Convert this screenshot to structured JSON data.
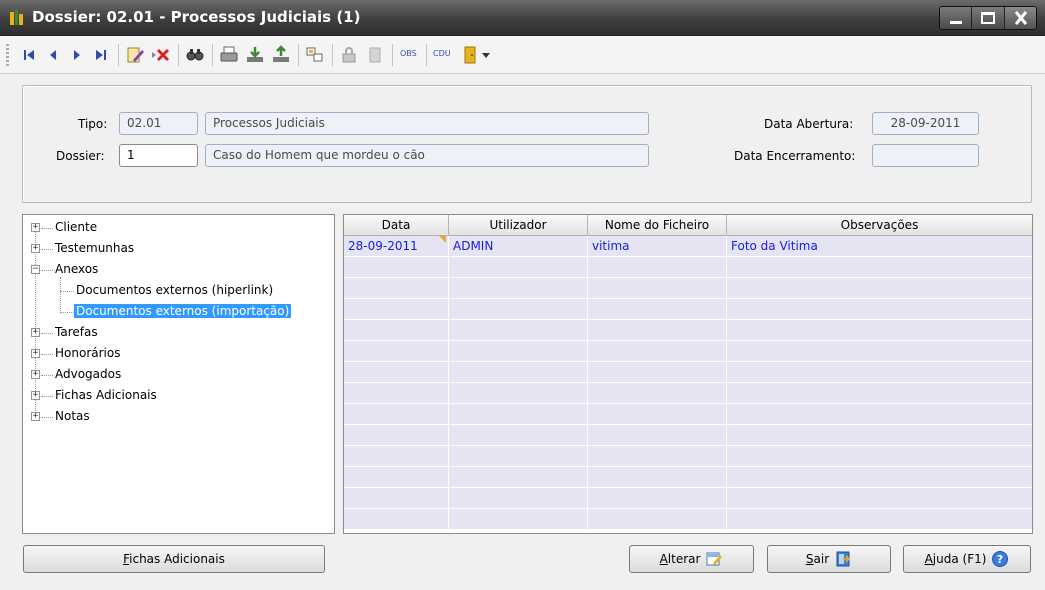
{
  "window": {
    "title": "Dossier: 02.01 - Processos Judiciais (1)",
    "controls": [
      "minimize-icon",
      "maximize-icon",
      "close-icon"
    ]
  },
  "toolbar": {
    "icons": [
      "first-record-icon",
      "previous-record-icon",
      "next-record-icon",
      "last-record-icon",
      "edit-record-icon",
      "delete-record-icon",
      "search-icon",
      "print-icon",
      "import-icon",
      "export-icon",
      "copy-icon",
      "lock-icon",
      "document-icon",
      "door-icon"
    ],
    "obs_label": "OBS",
    "cdu_label": "CDU"
  },
  "header": {
    "tipo_label": "Tipo:",
    "tipo_code": "02.01",
    "tipo_desc": "Processos Judiciais",
    "dossier_label": "Dossier:",
    "dossier_value": "1",
    "dossier_desc": "Caso do Homem que mordeu o cão",
    "data_abertura_label": "Data Abertura:",
    "data_abertura_value": "28-09-2011",
    "data_encerramento_label": "Data Encerramento:",
    "data_encerramento_value": ""
  },
  "tree": {
    "items": [
      {
        "label": "Cliente"
      },
      {
        "label": "Testemunhas"
      },
      {
        "label": "Anexos"
      },
      {
        "label": "Documentos externos (hiperlink)"
      },
      {
        "label": "Documentos externos (importação)"
      },
      {
        "label": "Tarefas"
      },
      {
        "label": "Honorários"
      },
      {
        "label": "Advogados"
      },
      {
        "label": "Fichas Adicionais"
      },
      {
        "label": "Notas"
      }
    ]
  },
  "grid": {
    "columns": [
      "Data",
      "Utilizador",
      "Nome do Ficheiro",
      "Observações"
    ],
    "rows": [
      {
        "data": "28-09-2011",
        "utilizador": "ADMIN",
        "ficheiro": "vitima",
        "obs": "Foto da Vitima"
      }
    ]
  },
  "buttons": {
    "fichas_first": "F",
    "fichas_rest": "ichas Adicionais",
    "alterar_first": "A",
    "alterar_rest": "lterar",
    "sair_first": "S",
    "sair_rest": "air",
    "ajuda_first": "A",
    "ajuda_rest": "juda (F1)"
  },
  "colors": {
    "selection": "#3399ff",
    "grid_row": "#e4e4f2",
    "grid_text": "#1a1ae6"
  }
}
